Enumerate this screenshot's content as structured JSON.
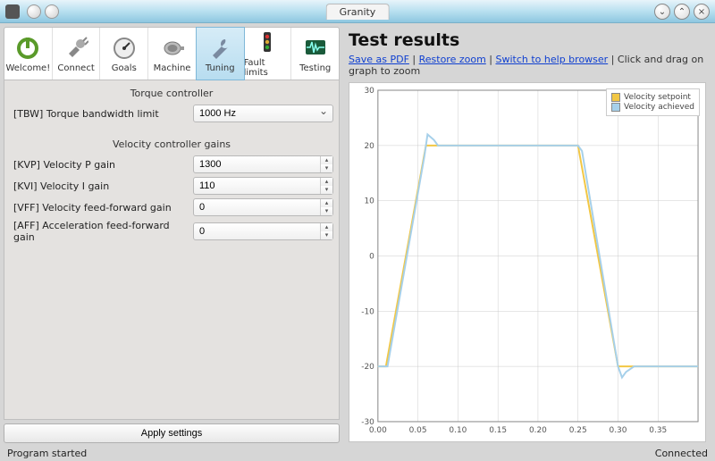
{
  "window": {
    "title": "Granity"
  },
  "tabs": [
    {
      "label": "Welcome!"
    },
    {
      "label": "Connect"
    },
    {
      "label": "Goals"
    },
    {
      "label": "Machine"
    },
    {
      "label": "Tuning"
    },
    {
      "label": "Fault limits"
    },
    {
      "label": "Testing"
    }
  ],
  "sections": {
    "torque": {
      "header": "Torque controller",
      "tbw_label": "[TBW] Torque bandwidth limit",
      "tbw_value": "1000 Hz"
    },
    "velocity": {
      "header": "Velocity controller gains",
      "kvp_label": "[KVP] Velocity P gain",
      "kvp_value": "1300",
      "kvi_label": "[KVI] Velocity I gain",
      "kvi_value": "110",
      "vff_label": "[VFF] Velocity feed-forward gain",
      "vff_value": "0",
      "aff_label": "[AFF] Acceleration feed-forward gain",
      "aff_value": "0"
    }
  },
  "apply_label": "Apply settings",
  "results": {
    "title": "Test results",
    "save_pdf": "Save as PDF",
    "restore_zoom": "Restore zoom",
    "help_browser": "Switch to help browser",
    "drag_hint": "Click and drag on graph to zoom",
    "legend": {
      "setpoint": "Velocity setpoint",
      "achieved": "Velocity achieved"
    }
  },
  "status": {
    "left": "Program started",
    "right": "Connected"
  },
  "colors": {
    "setpoint": "#f2c744",
    "achieved": "#a6d0ea",
    "grid": "#cccccc",
    "axis": "#333333"
  },
  "chart_data": {
    "type": "line",
    "xlabel": "",
    "ylabel": "",
    "xlim": [
      0.0,
      0.4
    ],
    "ylim": [
      -30,
      30
    ],
    "x_ticks": [
      0.0,
      0.05,
      0.1,
      0.15,
      0.2,
      0.25,
      0.3,
      0.35
    ],
    "y_ticks": [
      -30,
      -20,
      -10,
      0,
      10,
      20,
      30
    ],
    "series": [
      {
        "name": "Velocity setpoint",
        "color": "#f2c744",
        "x": [
          0.0,
          0.01,
          0.06,
          0.25,
          0.3,
          0.4
        ],
        "y": [
          -20,
          -20,
          20,
          20,
          -20,
          -20
        ]
      },
      {
        "name": "Velocity achieved",
        "color": "#a6d0ea",
        "x": [
          0.0,
          0.012,
          0.058,
          0.062,
          0.07,
          0.075,
          0.09,
          0.1,
          0.25,
          0.255,
          0.3,
          0.305,
          0.31,
          0.32,
          0.34,
          0.4
        ],
        "y": [
          -20,
          -20,
          18,
          22,
          21,
          20,
          20,
          20,
          20,
          19,
          -20,
          -22,
          -21,
          -20,
          -20,
          -20
        ]
      }
    ]
  }
}
